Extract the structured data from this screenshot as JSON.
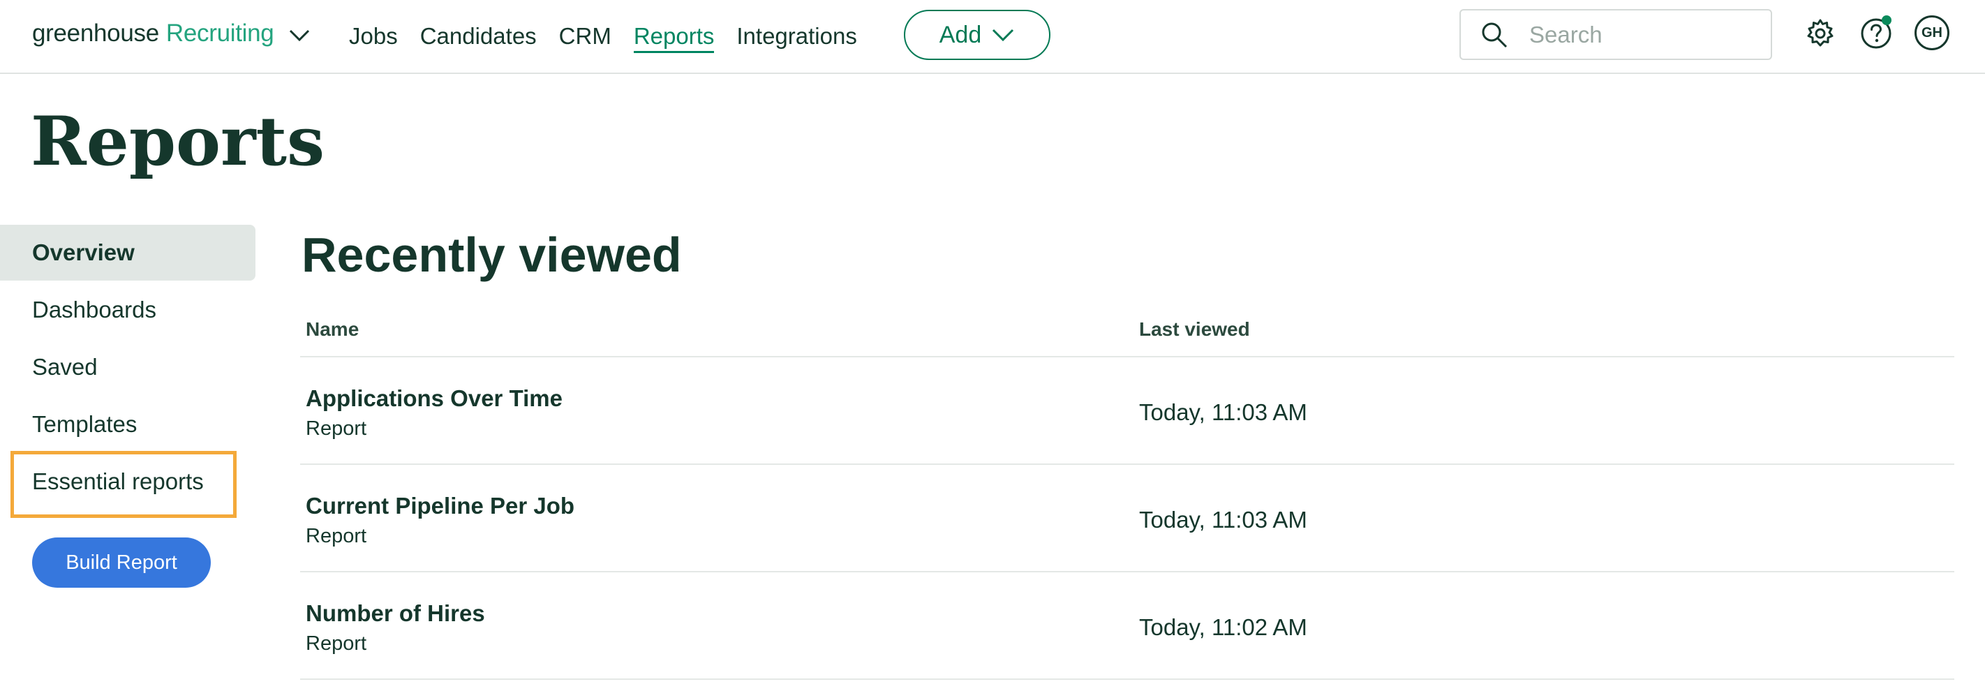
{
  "app": {
    "brand": "greenhouse",
    "product": "Recruiting"
  },
  "nav": {
    "items": [
      {
        "label": "Jobs",
        "active": false
      },
      {
        "label": "Candidates",
        "active": false
      },
      {
        "label": "CRM",
        "active": false
      },
      {
        "label": "Reports",
        "active": true
      },
      {
        "label": "Integrations",
        "active": false
      }
    ],
    "add_label": "Add",
    "search_placeholder": "Search",
    "avatar_initials": "GH"
  },
  "page": {
    "title": "Reports"
  },
  "sidebar": {
    "items": [
      {
        "label": "Overview",
        "active": true
      },
      {
        "label": "Dashboards",
        "active": false
      },
      {
        "label": "Saved",
        "active": false
      },
      {
        "label": "Templates",
        "active": false
      },
      {
        "label": "Essential reports",
        "active": false,
        "highlighted": true
      }
    ],
    "build_label": "Build Report"
  },
  "recent": {
    "title": "Recently viewed",
    "columns": {
      "name": "Name",
      "last_viewed": "Last viewed"
    },
    "rows": [
      {
        "name": "Applications Over Time",
        "type": "Report",
        "last_viewed": "Today, 11:03 AM"
      },
      {
        "name": "Current Pipeline Per Job",
        "type": "Report",
        "last_viewed": "Today, 11:03 AM"
      },
      {
        "name": "Number of Hires",
        "type": "Report",
        "last_viewed": "Today, 11:02 AM"
      }
    ]
  },
  "colors": {
    "brand_green": "#24a47f",
    "nav_active": "#008561",
    "primary_button": "#3677dd",
    "highlight_outline": "#f4a93a",
    "text_dark": "#15372c"
  }
}
